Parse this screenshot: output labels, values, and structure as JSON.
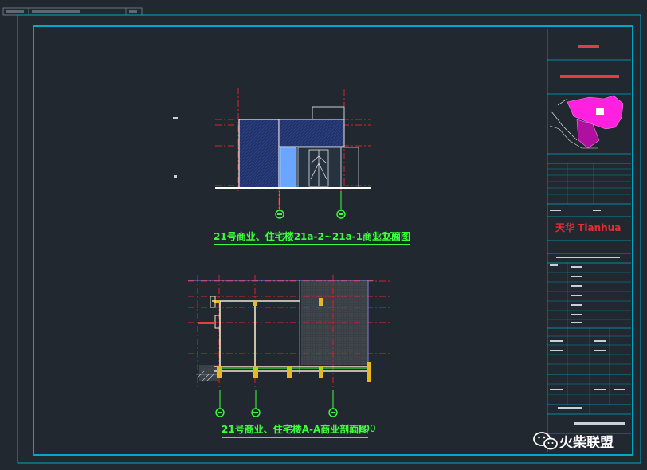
{
  "drawing": {
    "elevation_title": "21号商业、住宅楼21a-2~21a-1商业立面图",
    "elevation_scale": "1:100",
    "section_title": "21号商业、住宅楼A-A商业剖面图",
    "section_scale": "1:100"
  },
  "title_block": {
    "brand_logo": "天华 Tianhua"
  },
  "watermark": {
    "text": "火柴联盟",
    "icon": "wechat-icon"
  },
  "colors": {
    "background": "#212830",
    "frame": "#00a8c8",
    "title_green": "#3cff3c",
    "axis_red": "#e0202a",
    "site_magenta": "#ff20e0",
    "hatch_blue": "#2c3e7a",
    "glass_blue": "#6aa6ff"
  }
}
